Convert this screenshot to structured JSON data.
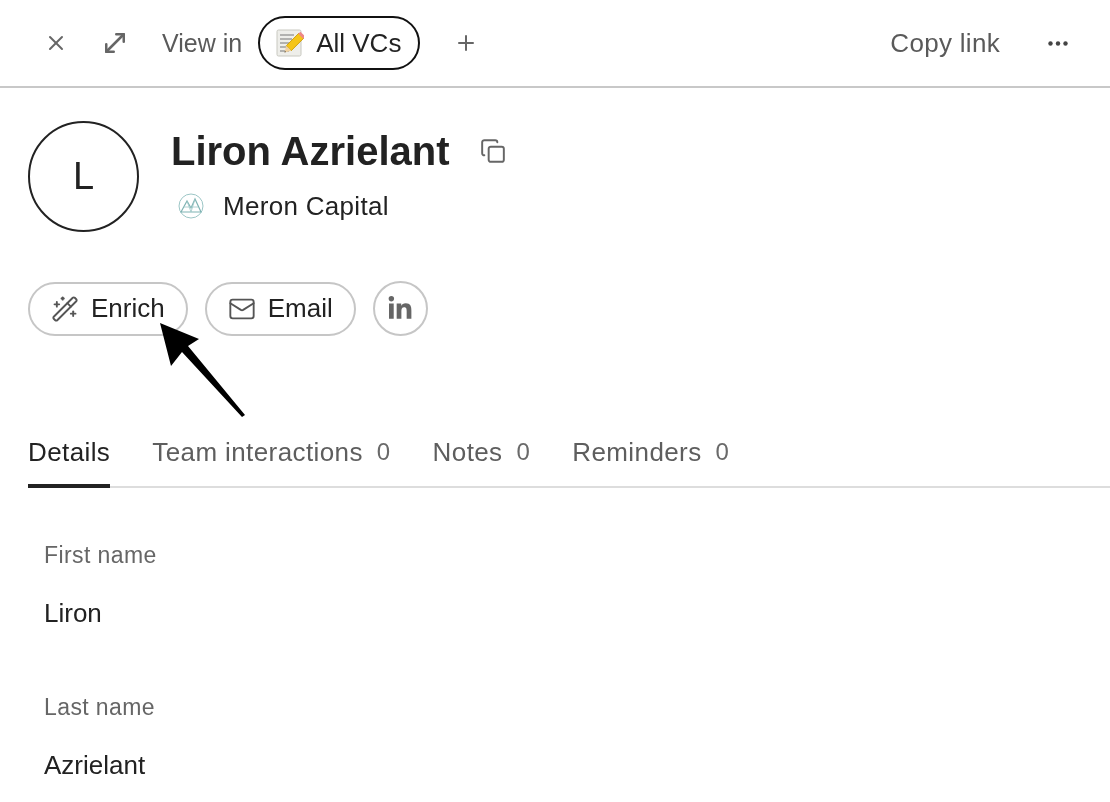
{
  "toolbar": {
    "view_in_label": "View in",
    "view": {
      "label": "All VCs"
    },
    "copy_link": "Copy link"
  },
  "profile": {
    "avatar_initial": "L",
    "name": "Liron Azrielant",
    "company": "Meron Capital"
  },
  "actions": [
    {
      "kind": "enrich",
      "label": "Enrich"
    },
    {
      "kind": "email",
      "label": "Email"
    },
    {
      "kind": "linkedin"
    }
  ],
  "tabs": [
    {
      "label": "Details",
      "selected": true
    },
    {
      "label": "Team interactions",
      "count": "0",
      "selected": false
    },
    {
      "label": "Notes",
      "count": "0",
      "selected": false
    },
    {
      "label": "Reminders",
      "count": "0",
      "selected": false
    }
  ],
  "fields": [
    {
      "label": "First name",
      "value": "Liron"
    },
    {
      "label": "Last name",
      "value": "Azrielant"
    }
  ]
}
